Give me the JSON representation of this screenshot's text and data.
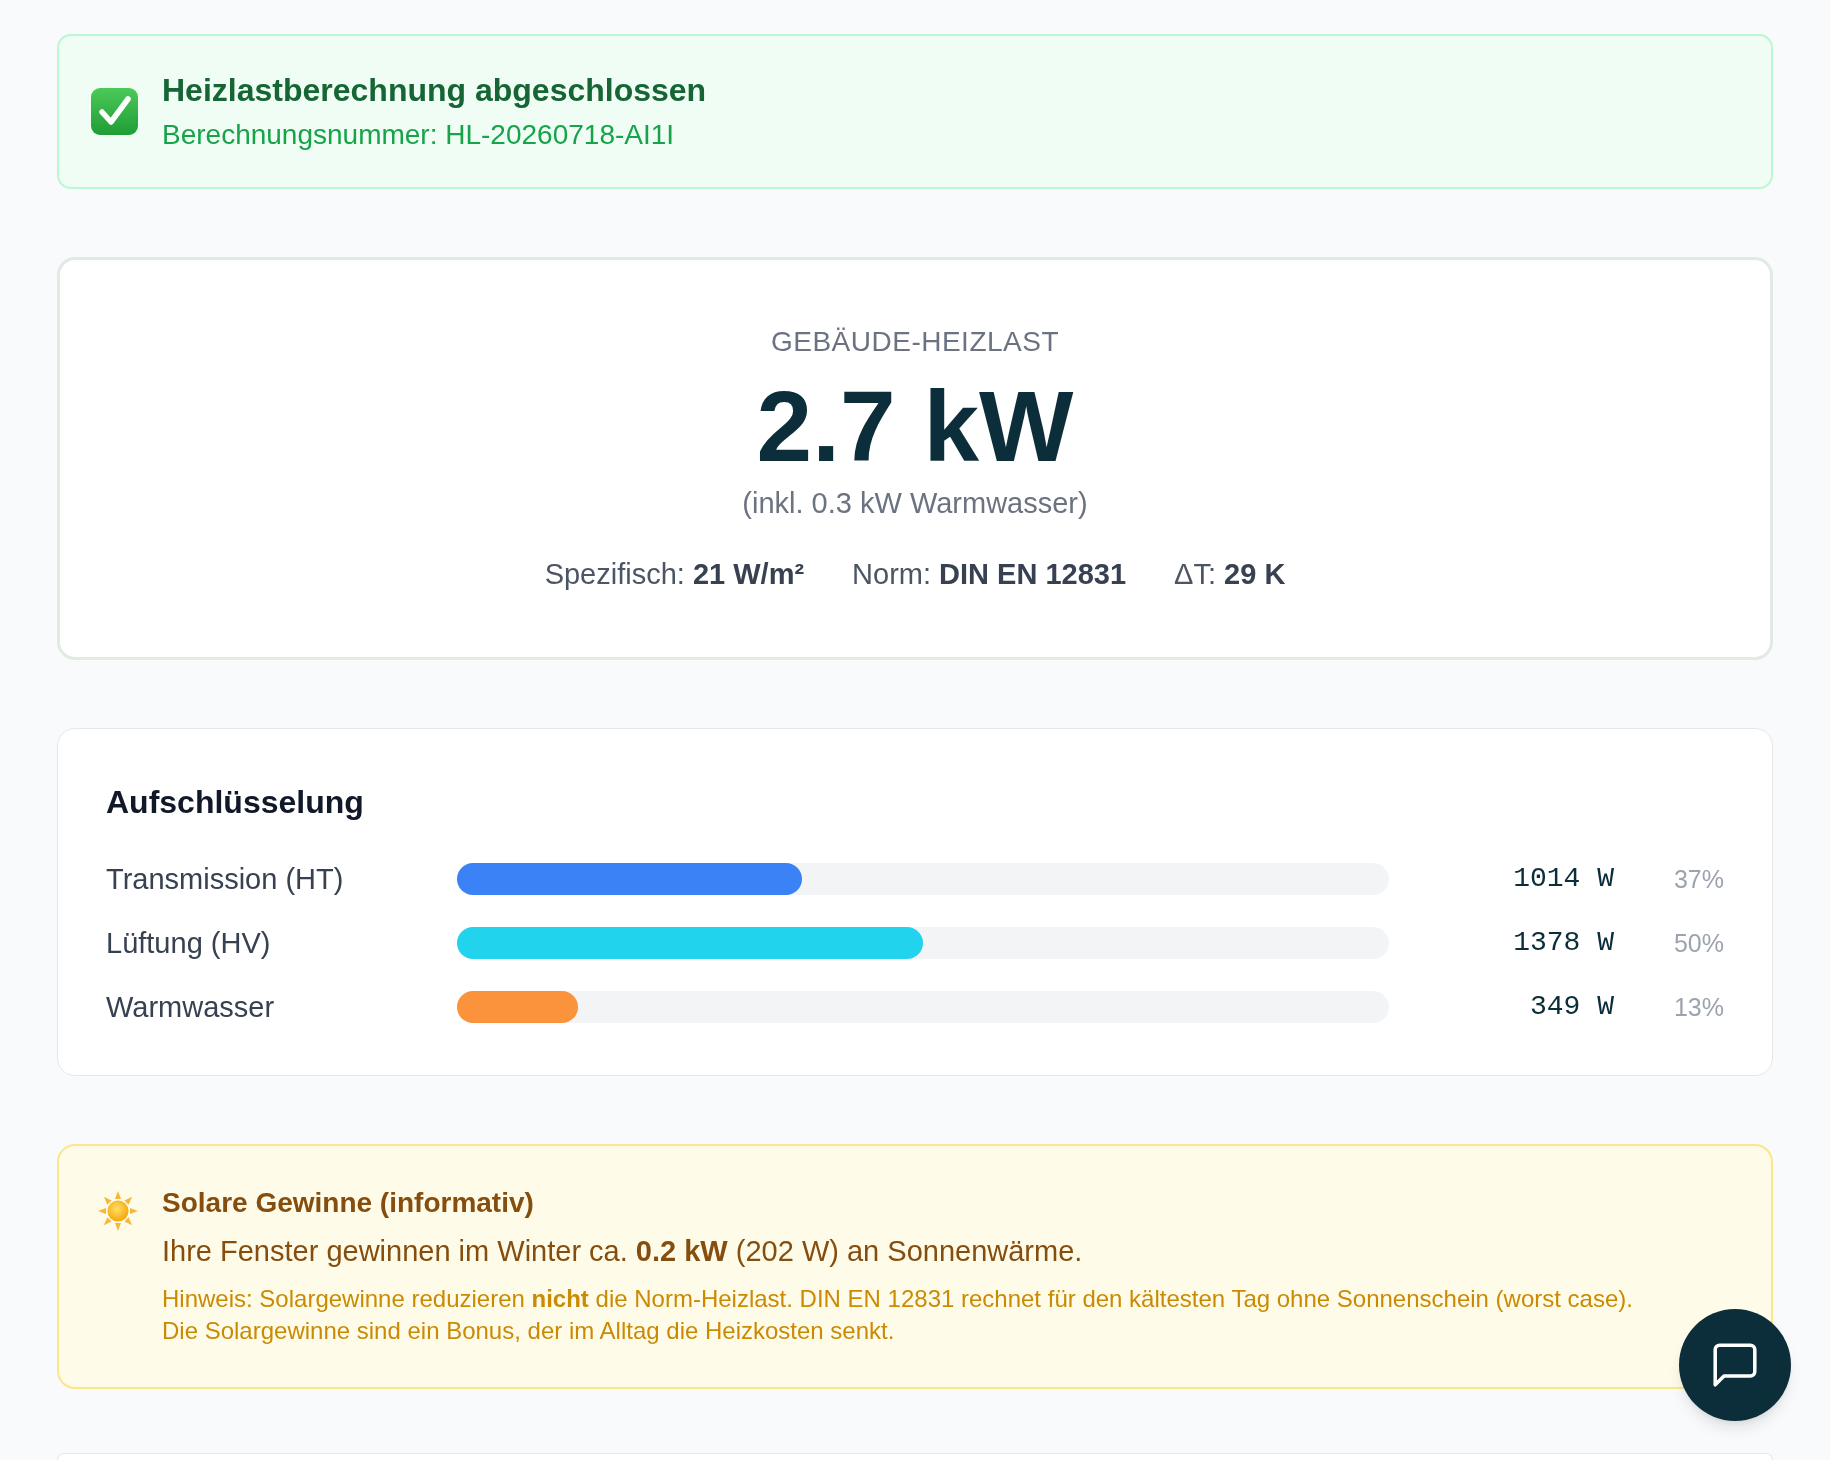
{
  "banner": {
    "title": "Heizlastberechnung abgeschlossen",
    "subtitle": "Berechnungsnummer: HL-20260718-AI1I"
  },
  "summary": {
    "label": "GEBÄUDE-HEIZLAST",
    "value": "2.7 kW",
    "note": "(inkl. 0.3 kW Warmwasser)",
    "stats": [
      "Spezifisch: **21 W/m²**",
      "Norm: **DIN EN 12831**",
      "ΔT: **29 K**"
    ]
  },
  "breakdown": {
    "title": "Aufschlüsselung",
    "items": [
      {
        "name": "Transmission (HT)",
        "level": 0.37,
        "color": "#3b82f6",
        "reading": "1014 W",
        "share": "37%"
      },
      {
        "name": "Lüftung (HV)",
        "level": 0.5,
        "color": "#22d3ee",
        "reading": "1378 W",
        "share": "50%"
      },
      {
        "name": "Warmwasser",
        "level": 0.13,
        "color": "#fb923c",
        "reading": "349 W",
        "share": "13%"
      }
    ]
  },
  "solar": {
    "title": "Solare Gewinne (informativ)",
    "text": "Ihre Fenster gewinnen im Winter ca. **0.2 kW** (202 W) an Sonnenwärme.",
    "note": "Hinweis: Solargewinne reduzieren **nicht** die Norm-Heizlast. DIN EN 12831 rechnet für den kältesten Tag ohne Sonnenschein (worst case). Die Solargewinne sind ein Bonus, der im Alltag die Heizkosten senkt."
  }
}
